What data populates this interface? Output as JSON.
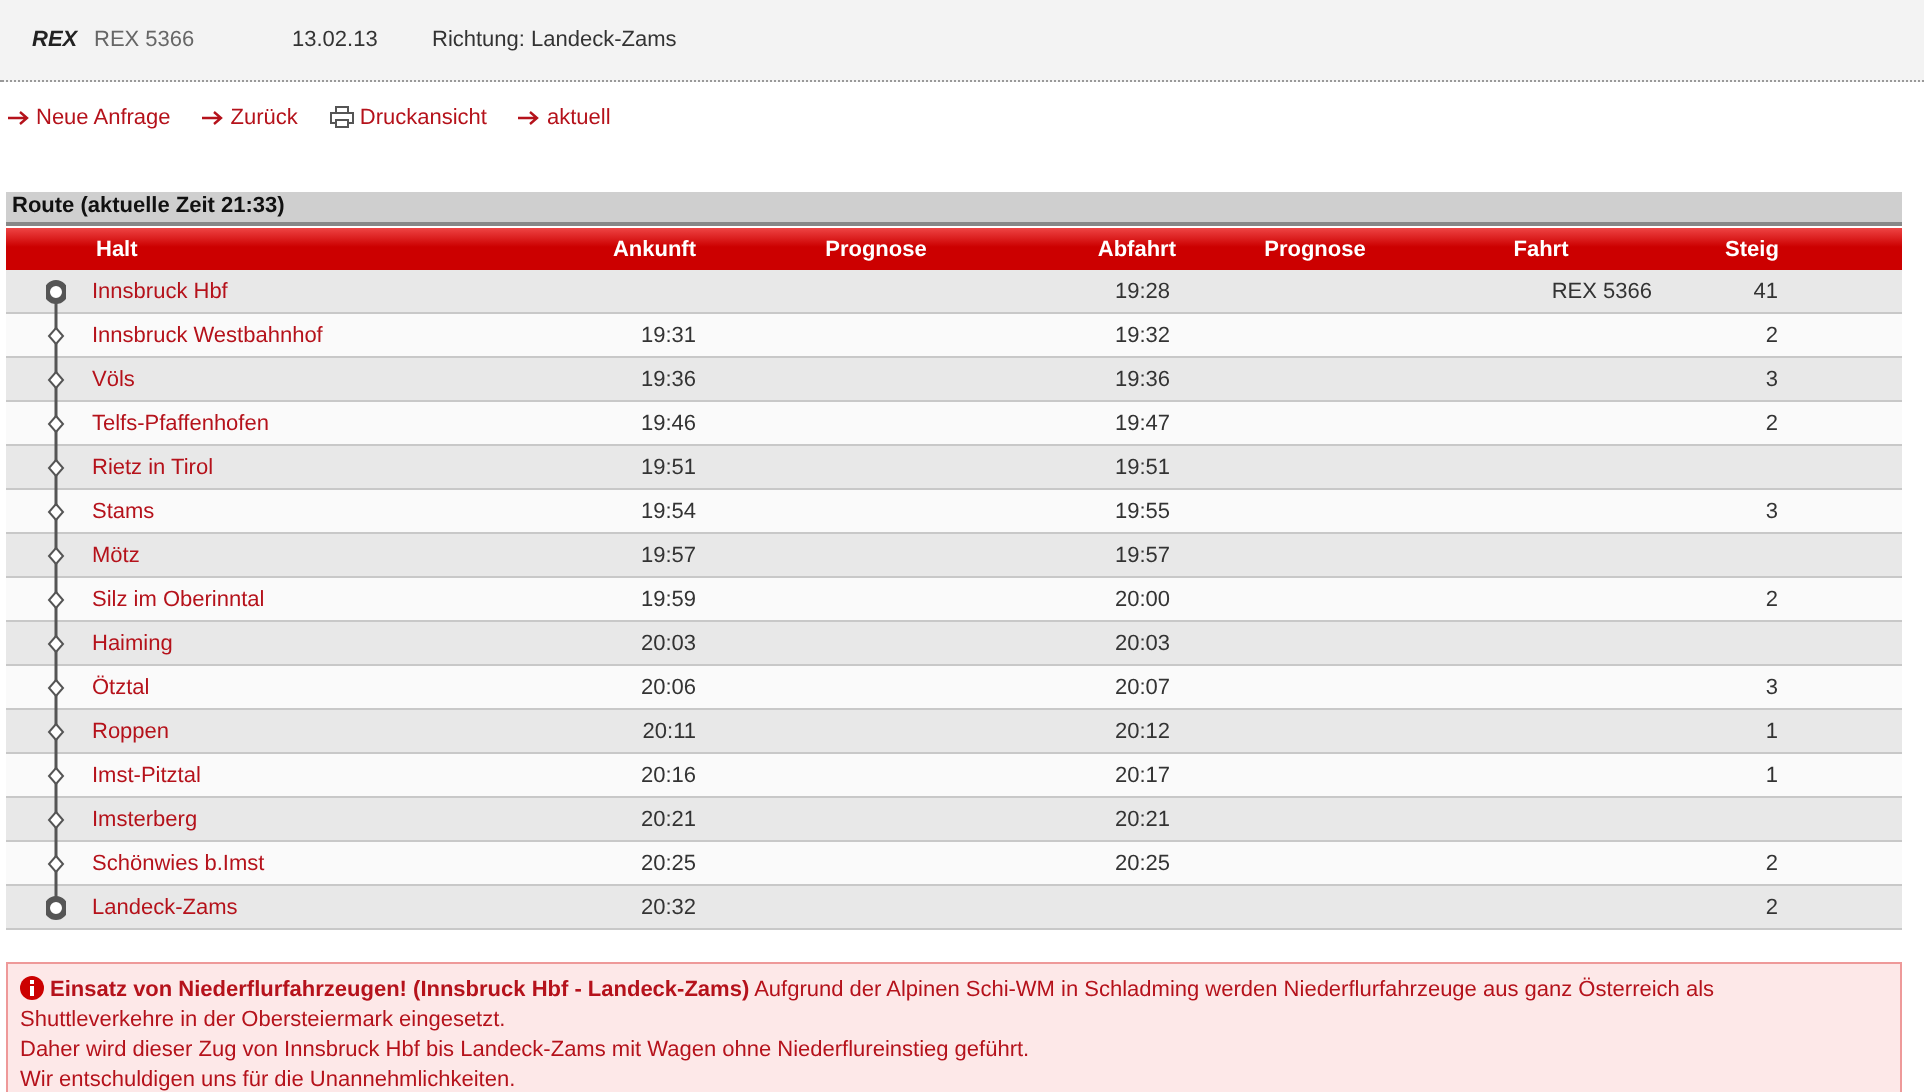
{
  "header": {
    "category": "REX",
    "train": "REX 5366",
    "date": "13.02.13",
    "direction": "Richtung: Landeck-Zams"
  },
  "links": [
    {
      "label": "Neue Anfrage",
      "kind": "arrow"
    },
    {
      "label": "Zurück",
      "kind": "arrow"
    },
    {
      "label": "Druckansicht",
      "kind": "print"
    },
    {
      "label": "aktuell",
      "kind": "arrow"
    }
  ],
  "route": {
    "title": "Route (aktuelle Zeit 21:33)",
    "columns": [
      "Halt",
      "Ankunft",
      "Prognose",
      "Abfahrt",
      "Prognose",
      "Fahrt",
      "Steig"
    ],
    "rows": [
      {
        "kind": "end",
        "halt": "Innsbruck Hbf",
        "departure": "19:28",
        "train": "REX 5366",
        "platform": "41"
      },
      {
        "kind": "stop",
        "halt": "Innsbruck Westbahnhof",
        "arrival": "19:31",
        "departure": "19:32",
        "platform": "2"
      },
      {
        "kind": "stop",
        "halt": "Völs",
        "arrival": "19:36",
        "departure": "19:36",
        "platform": "3"
      },
      {
        "kind": "stop",
        "halt": "Telfs-Pfaffenhofen",
        "arrival": "19:46",
        "departure": "19:47",
        "platform": "2"
      },
      {
        "kind": "stop",
        "halt": "Rietz in Tirol",
        "arrival": "19:51",
        "departure": "19:51"
      },
      {
        "kind": "stop",
        "halt": "Stams",
        "arrival": "19:54",
        "departure": "19:55",
        "platform": "3"
      },
      {
        "kind": "stop",
        "halt": "Mötz",
        "arrival": "19:57",
        "departure": "19:57"
      },
      {
        "kind": "stop",
        "halt": "Silz im Oberinntal",
        "arrival": "19:59",
        "departure": "20:00",
        "platform": "2"
      },
      {
        "kind": "stop",
        "halt": "Haiming",
        "arrival": "20:03",
        "departure": "20:03"
      },
      {
        "kind": "stop",
        "halt": "Ötztal",
        "arrival": "20:06",
        "departure": "20:07",
        "platform": "3"
      },
      {
        "kind": "stop",
        "halt": "Roppen",
        "arrival": "20:11",
        "departure": "20:12",
        "platform": "1"
      },
      {
        "kind": "stop",
        "halt": "Imst-Pitztal",
        "arrival": "20:16",
        "departure": "20:17",
        "platform": "1"
      },
      {
        "kind": "stop",
        "halt": "Imsterberg",
        "arrival": "20:21",
        "departure": "20:21"
      },
      {
        "kind": "stop",
        "halt": "Schönwies b.Imst",
        "arrival": "20:25",
        "departure": "20:25",
        "platform": "2"
      },
      {
        "kind": "end",
        "halt": "Landeck-Zams",
        "arrival": "20:32",
        "platform": "2"
      }
    ]
  },
  "notice": {
    "title": "Einsatz von Niederflurfahrzeugen! (Innsbruck Hbf - Landeck-Zams)",
    "lines": [
      "Aufgrund der Alpinen Schi-WM in Schladming werden Niederflurfahrzeuge aus ganz Österreich als Shuttleverkehre in der Obersteiermark eingesetzt.",
      "Daher wird dieser Zug von Innsbruck Hbf bis Landeck-Zams mit Wagen ohne Niederflureinstieg geführt.",
      "Wir entschuldigen uns für die Unannehmlichkeiten."
    ]
  }
}
